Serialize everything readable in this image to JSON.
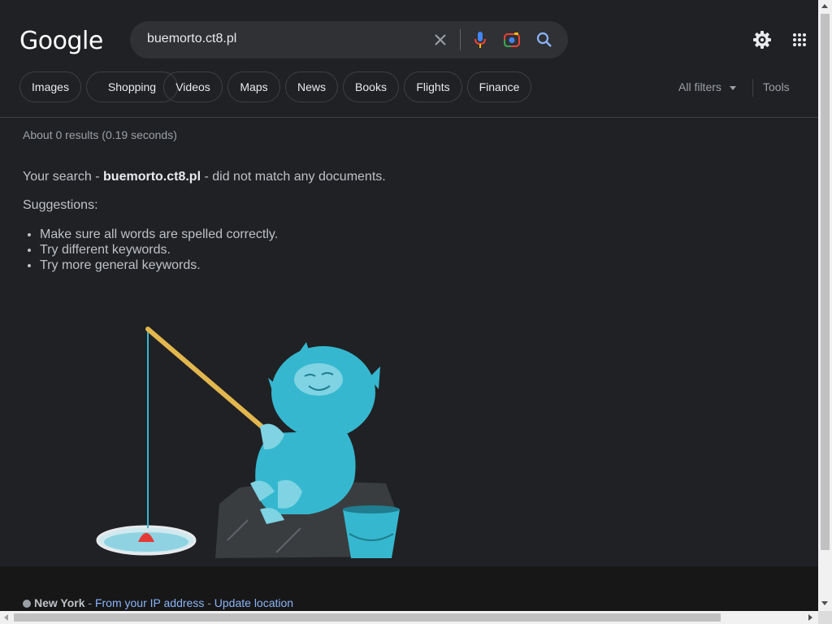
{
  "logo": "Google",
  "search": {
    "query": "buemorto.ct8.pl"
  },
  "icons": {
    "clear": "close-icon",
    "voice": "mic-icon",
    "lens": "camera-icon",
    "search": "search-icon",
    "settings": "gear-icon",
    "apps": "apps-grid-icon"
  },
  "tabs": [
    {
      "label": "Images"
    },
    {
      "label": "Shopping"
    },
    {
      "label": "Videos"
    },
    {
      "label": "Maps"
    },
    {
      "label": "News"
    },
    {
      "label": "Books"
    },
    {
      "label": "Flights"
    },
    {
      "label": "Finance"
    }
  ],
  "filters": {
    "all_filters": "All filters",
    "tools": "Tools"
  },
  "results": {
    "stats": "About 0 results (0.19 seconds)",
    "no_match_prefix": "Your search - ",
    "no_match_query": "buemorto.ct8.pl",
    "no_match_suffix": " - did not match any documents.",
    "suggestions_label": "Suggestions:",
    "suggestions": [
      "Make sure all words are spelled correctly.",
      "Try different keywords.",
      "Try more general keywords."
    ]
  },
  "footer": {
    "location": "New York",
    "sep1": " - ",
    "ip_link": "From your IP address",
    "sep2": " - ",
    "update_link": "Update location"
  },
  "colors": {
    "background": "#202124",
    "link": "#8ab4f8",
    "creature": "#35b8cf",
    "rod": "#e2b74e"
  }
}
